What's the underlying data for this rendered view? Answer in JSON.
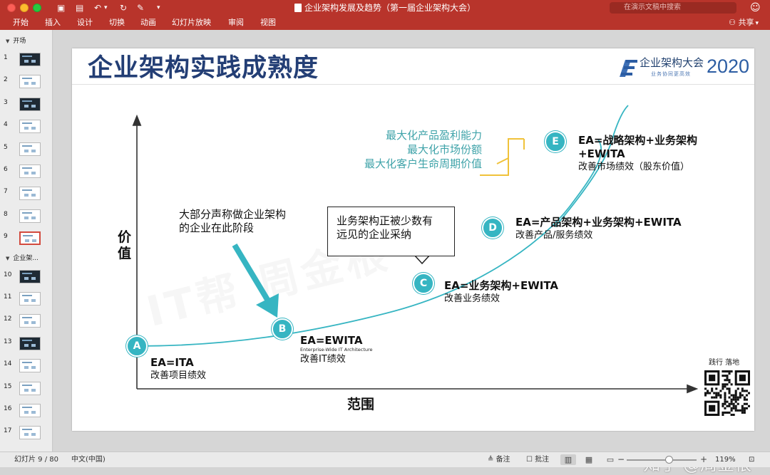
{
  "window": {
    "title": "企业架构发展及趋势（第一届企业架构大会）",
    "search_placeholder": "在演示文稿中搜索"
  },
  "ribbon": {
    "tabs": [
      "开始",
      "插入",
      "设计",
      "切换",
      "动画",
      "幻灯片放映",
      "审阅",
      "视图"
    ],
    "share_label": "共享"
  },
  "sidebar": {
    "sections": [
      {
        "label": "开场",
        "before_slide": 1
      },
      {
        "label": "企业架...",
        "before_slide": 10
      }
    ],
    "slides": [
      {
        "num": "1",
        "theme": "photo"
      },
      {
        "num": "2",
        "theme": "light"
      },
      {
        "num": "3",
        "theme": "dark"
      },
      {
        "num": "4",
        "theme": "light"
      },
      {
        "num": "5",
        "theme": "light"
      },
      {
        "num": "6",
        "theme": "light"
      },
      {
        "num": "7",
        "theme": "light"
      },
      {
        "num": "8",
        "theme": "light"
      },
      {
        "num": "9",
        "theme": "light",
        "selected": true
      },
      {
        "num": "10",
        "theme": "dark"
      },
      {
        "num": "11",
        "theme": "light"
      },
      {
        "num": "12",
        "theme": "light"
      },
      {
        "num": "13",
        "theme": "dark"
      },
      {
        "num": "14",
        "theme": "light"
      },
      {
        "num": "15",
        "theme": "light"
      },
      {
        "num": "16",
        "theme": "light"
      },
      {
        "num": "17",
        "theme": "light"
      }
    ]
  },
  "slide": {
    "title": "企业架构实践成熟度",
    "logo_text": "企业架构大会",
    "logo_year": "2020",
    "logo_sub": "业务协同更高效",
    "watermark": "IT帮 周金根",
    "axis_y": "价值",
    "axis_x": "范围",
    "annotation_left": [
      "大部分声称做企业架构",
      "的企业在此阶段"
    ],
    "callout": [
      "业务架构正被少数有",
      "远见的企业采纳"
    ],
    "goals": [
      "最大化产品盈利能力",
      "最大化市场份额",
      "最大化客户生命周期价值"
    ],
    "stages": [
      {
        "letter": "A",
        "title": [
          "EA=ITA"
        ],
        "desc": "改善项目绩效"
      },
      {
        "letter": "B",
        "title": [
          "EA=EWITA"
        ],
        "note": "Enterprise-Wide IT Architecture",
        "desc": "改善IT绩效"
      },
      {
        "letter": "C",
        "title": [
          "EA=业务架构+EWITA"
        ],
        "desc": "改善业务绩效"
      },
      {
        "letter": "D",
        "title": [
          "EA=产品架构+业务架构+EWITA"
        ],
        "desc": "改善产品/服务绩效"
      },
      {
        "letter": "E",
        "title": [
          "EA=战略架构+业务架构",
          "+EWITA"
        ],
        "desc": "改善市场绩效（股东价值）"
      }
    ],
    "qr_label": "践行  落地"
  },
  "colors": {
    "ribbon": "#b8342b",
    "title": "#233e75",
    "teal": "#36b5c2",
    "bracket": "#f0c23a"
  },
  "statusbar": {
    "slide_counter": "幻灯片 9 / 80",
    "language": "中文(中国)",
    "notes_label": "备注",
    "comments_label": "批注",
    "zoom": "119%",
    "zoom_level_percent": 60
  },
  "overlay_watermark": "知乎 @周金根"
}
